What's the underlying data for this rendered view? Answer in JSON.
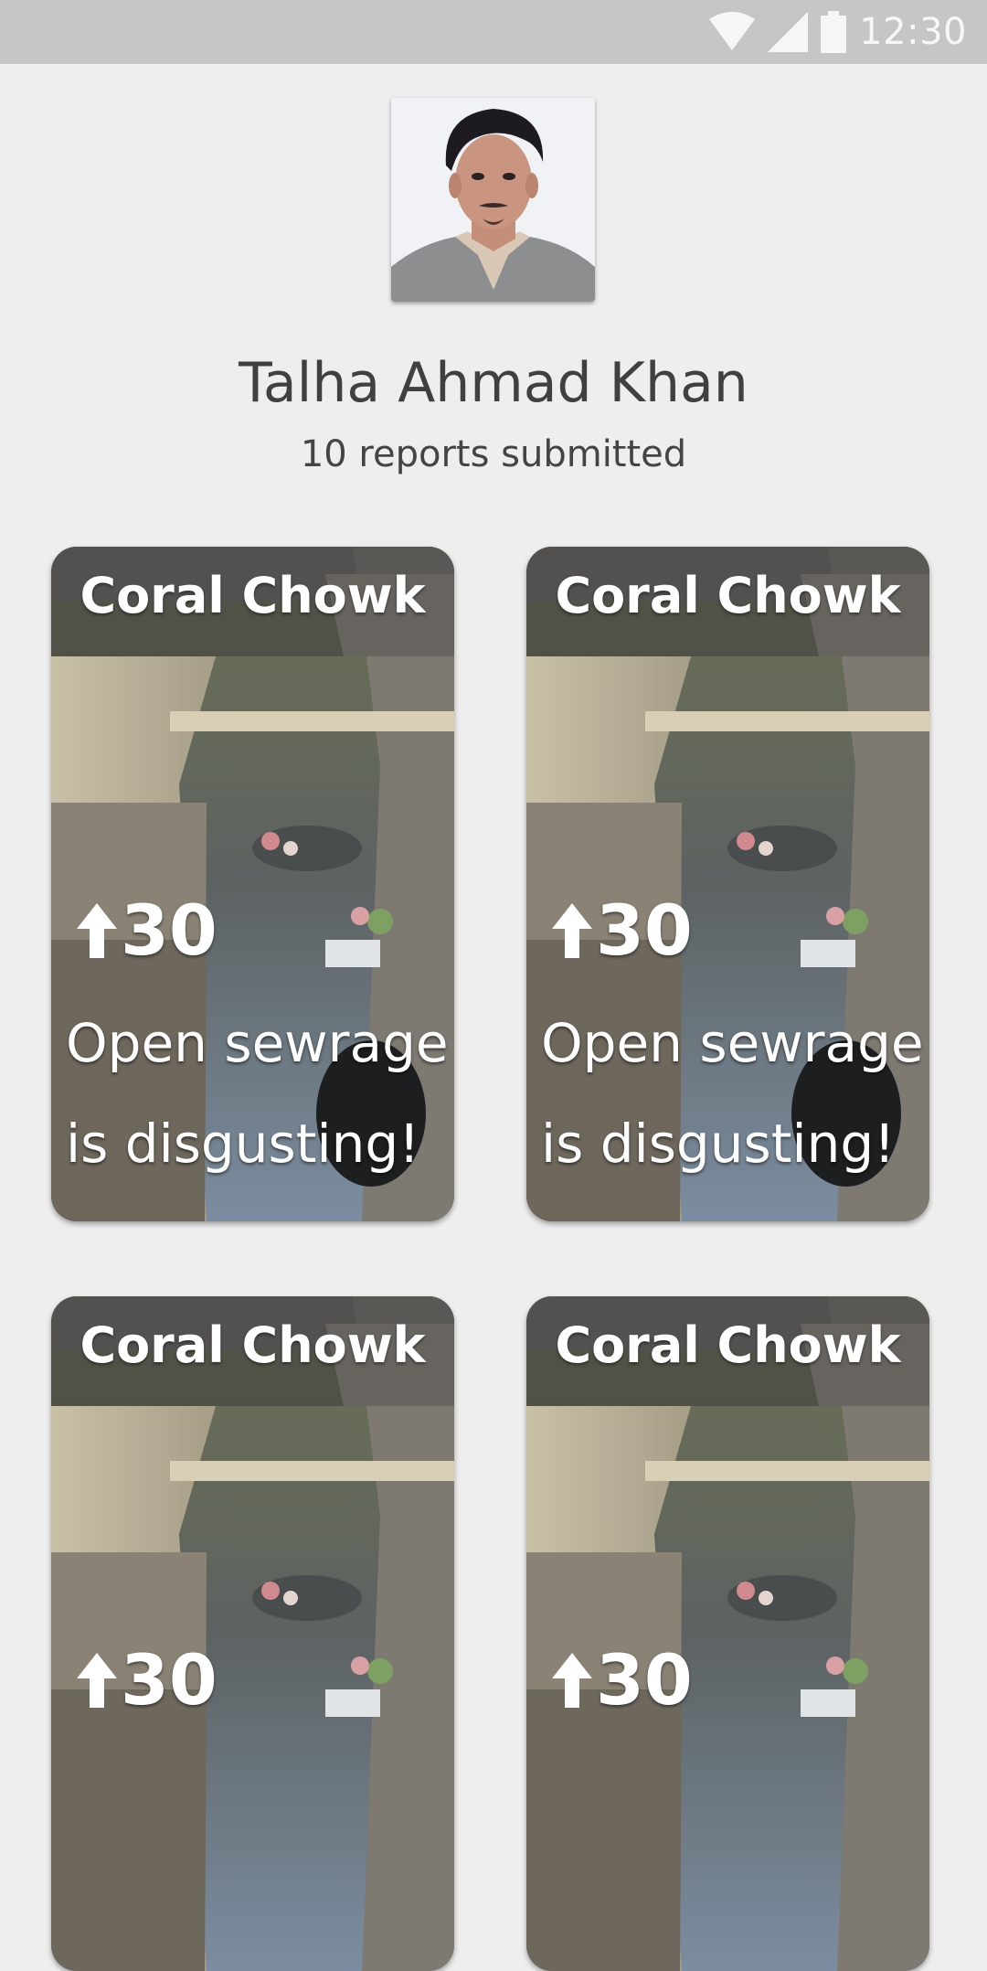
{
  "status_bar": {
    "time": "12:30",
    "icons": [
      "wifi-icon",
      "cellular-signal-icon",
      "battery-icon"
    ]
  },
  "profile": {
    "name": "Talha Ahmad Khan",
    "reports_text": "10 reports submitted"
  },
  "reports": [
    {
      "location": "Coral Chowk",
      "upvotes": "30",
      "description": "Open sewrage is disgusting!"
    },
    {
      "location": "Coral Chowk",
      "upvotes": "30",
      "description": "Open sewrage is disgusting!"
    },
    {
      "location": "Coral Chowk",
      "upvotes": "30",
      "description": ""
    },
    {
      "location": "Coral Chowk",
      "upvotes": "30",
      "description": ""
    }
  ],
  "colors": {
    "status_bar": "#c6c6c6",
    "background": "#eeeeee",
    "text_primary": "#404040"
  }
}
